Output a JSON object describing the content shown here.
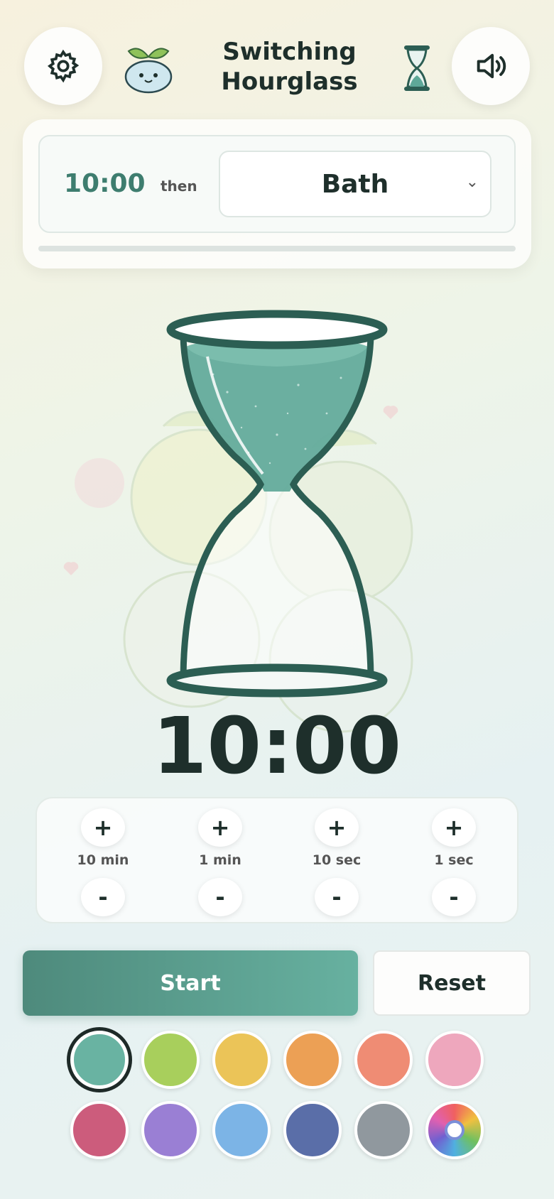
{
  "header": {
    "title_line1": "Switching",
    "title_line2": "Hourglass",
    "settings_icon": "gear-icon",
    "mascot_icon": "sprout-mascot-icon",
    "hourglass_icon": "hourglass-icon",
    "sound_icon": "speaker-icon"
  },
  "schedule": {
    "time": "10:00",
    "then_label": "then",
    "next_activity": "Bath",
    "progress": 0
  },
  "timer": {
    "display": "10:00",
    "sand_color": "#5ea898",
    "frame_color": "#2c5e53"
  },
  "adjust": [
    {
      "label": "10 min",
      "plus": "+",
      "minus": "-"
    },
    {
      "label": "1 min",
      "plus": "+",
      "minus": "-"
    },
    {
      "label": "10 sec",
      "plus": "+",
      "minus": "-"
    },
    {
      "label": "1 sec",
      "plus": "+",
      "minus": "-"
    }
  ],
  "actions": {
    "start_label": "Start",
    "reset_label": "Reset"
  },
  "colors": {
    "selected": "#69b3a2",
    "swatches": [
      "#69b3a2",
      "#a8cf5c",
      "#ebc458",
      "#eca055",
      "#ef8c74",
      "#eea7bd",
      "#cc5c7c",
      "#9a7fd4",
      "#7cb4e6",
      "#5a6ea8",
      "#90989e",
      "custom"
    ]
  }
}
